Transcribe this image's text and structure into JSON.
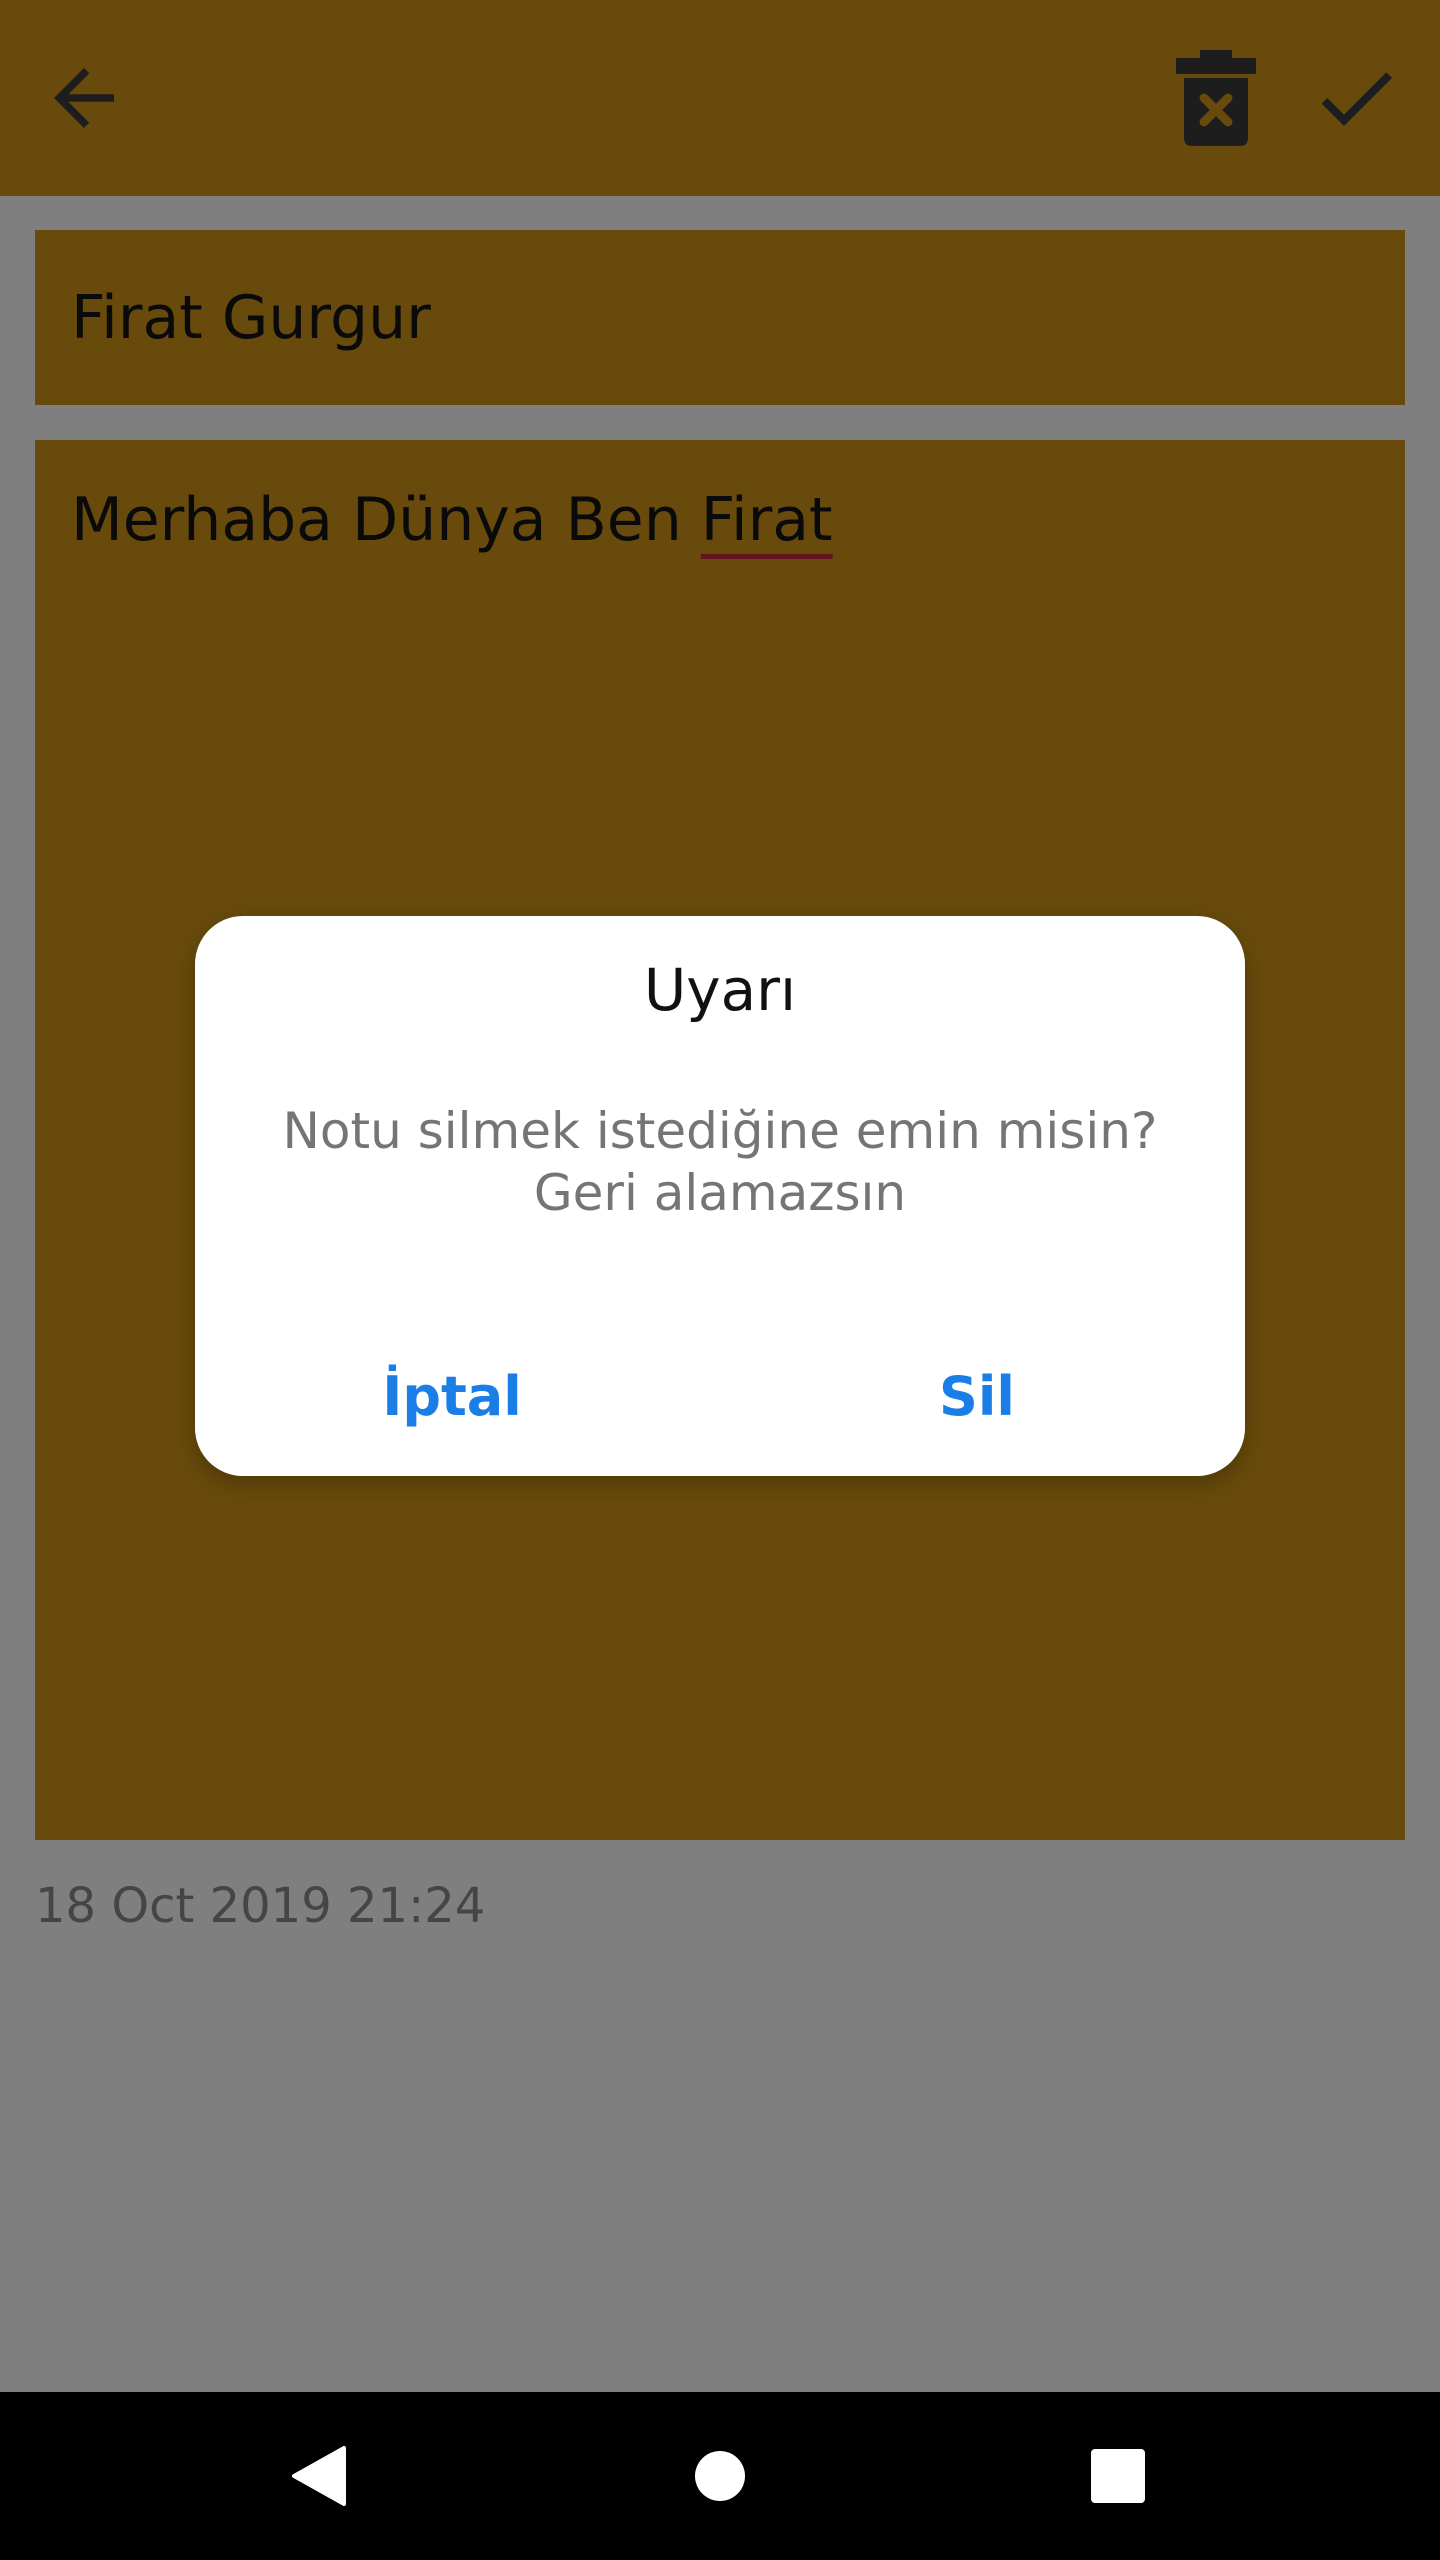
{
  "colors": {
    "note_yellow": "#d19718",
    "dialog_button": "#1a7ee6"
  },
  "appbar": {
    "back_icon": "arrow-left-icon",
    "delete_icon": "trash-x-icon",
    "confirm_icon": "check-icon"
  },
  "note": {
    "title": "Firat Gurgur",
    "body_prefix": "Merhaba Dünya Ben ",
    "body_misspelled": "Firat",
    "date": "18 Oct 2019 21:24"
  },
  "dialog": {
    "title": "Uyarı",
    "message": "Notu silmek istediğine emin misin? Geri alamazsın",
    "cancel_label": "İptal",
    "delete_label": "Sil"
  },
  "navbar": {
    "back_icon": "triangle-back-icon",
    "home_icon": "circle-home-icon",
    "recents_icon": "square-recents-icon"
  }
}
